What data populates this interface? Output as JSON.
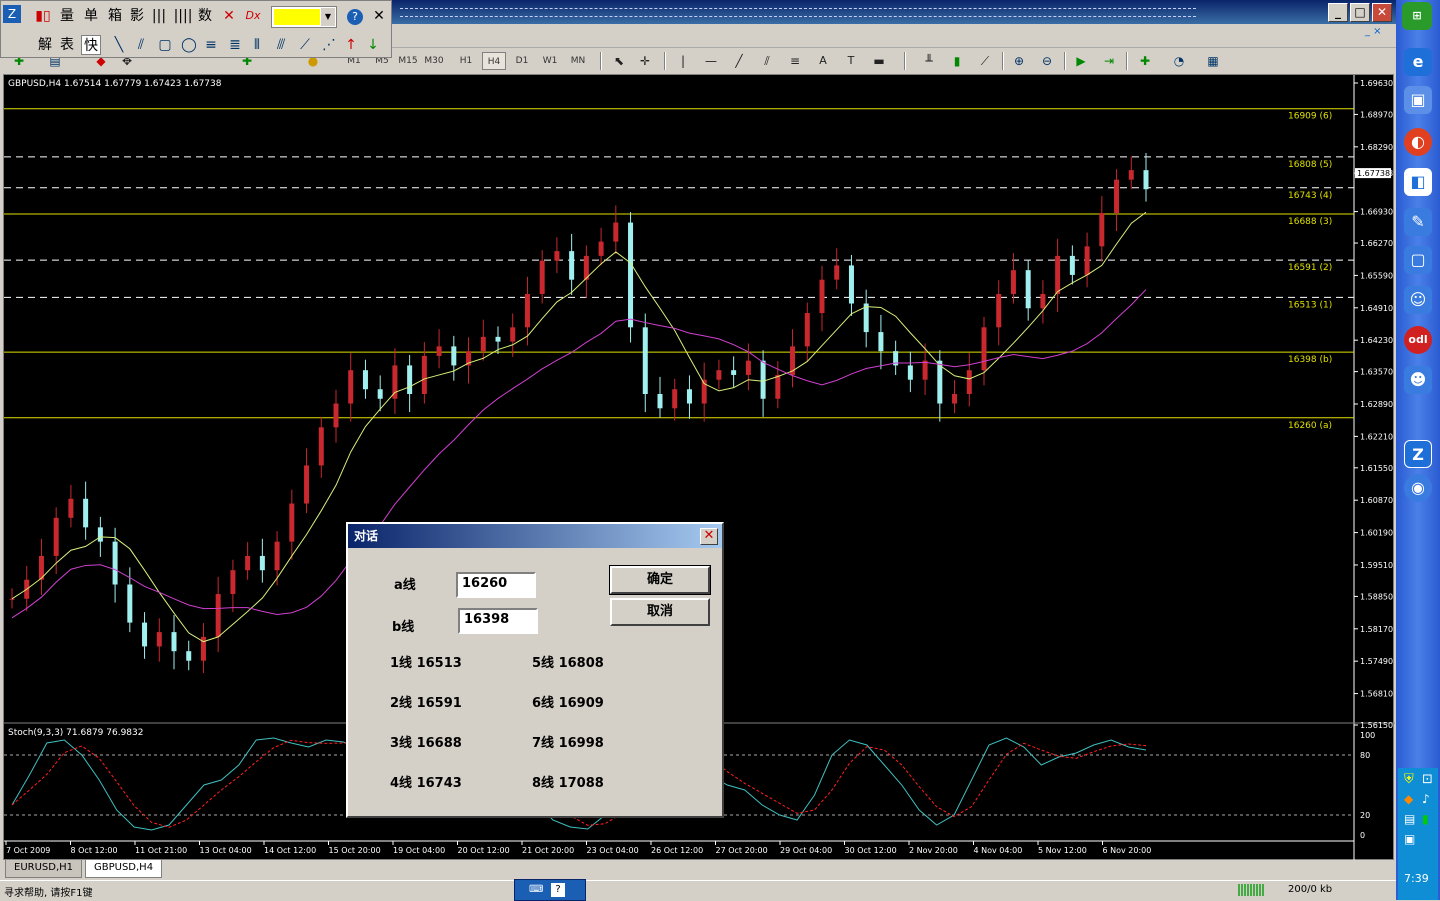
{
  "toolbar_float": {
    "row1": [
      "量",
      "单",
      "箱",
      "影",
      "数"
    ],
    "row2": [
      "解",
      "表",
      "快"
    ]
  },
  "timeframes": [
    "M1",
    "M5",
    "M15",
    "M30",
    "H1",
    "H4",
    "D1",
    "W1",
    "MN"
  ],
  "timeframe_selected": "H4",
  "chart": {
    "header": "GBPUSD,H4  1.67514 1.67779 1.67423 1.67738",
    "price_labels": [
      "1.69630",
      "1.68970",
      "1.68290",
      "1.67738",
      "1.66930",
      "1.66270",
      "1.65590",
      "1.64910",
      "1.64230",
      "1.63570",
      "1.62890",
      "1.62210",
      "1.61550",
      "1.60870",
      "1.60190",
      "1.59510",
      "1.58850",
      "1.58170",
      "1.57490",
      "1.56810",
      "1.56150"
    ],
    "current_price": "1.67738",
    "levels": [
      {
        "label": "16909 (6)",
        "value": 16909,
        "style": "solid"
      },
      {
        "label": "16808 (5)",
        "value": 16808,
        "style": "dashed"
      },
      {
        "label": "16743 (4)",
        "value": 16743,
        "style": "dashed"
      },
      {
        "label": "16688 (3)",
        "value": 16688,
        "style": "solid"
      },
      {
        "label": "16591 (2)",
        "value": 16591,
        "style": "dashed"
      },
      {
        "label": "16513 (1)",
        "value": 16513,
        "style": "dashed"
      },
      {
        "label": "16398 (b)",
        "value": 16398,
        "style": "solid"
      },
      {
        "label": "16260 (a)",
        "value": 16260,
        "style": "solid"
      }
    ],
    "stoch_label": "Stoch(9,3,3) 71.6879 76.9832",
    "stoch_levels": [
      "100",
      "80",
      "20",
      "0"
    ],
    "time_labels": [
      "7 Oct 2009",
      "8 Oct 12:00",
      "11 Oct 21:00",
      "13 Oct 04:00",
      "14 Oct 12:00",
      "15 Oct 20:00",
      "19 Oct 04:00",
      "20 Oct 12:00",
      "21 Oct 20:00",
      "23 Oct 04:00",
      "26 Oct 12:00",
      "27 Oct 20:00",
      "29 Oct 04:00",
      "30 Oct 12:00",
      "2 Nov 20:00",
      "4 Nov 04:00",
      "5 Nov 12:00",
      "6 Nov 20:00"
    ],
    "colors": {
      "bull": "#c8282e",
      "bear": "#a0f0f0",
      "ma_fast": "#d8f07a",
      "ma_slow": "#d040d0",
      "level": "#e0e000",
      "stoch_main": "#40c0c0",
      "stoch_signal": "#ff2020"
    }
  },
  "tabs": [
    "EURUSD,H1",
    "GBPUSD,H4"
  ],
  "active_tab": "GBPUSD,H4",
  "status": {
    "help": "寻求帮助, 请按F1键",
    "traffic": "200/0 kb",
    "clock": "7:39"
  },
  "dialog": {
    "title": "对话",
    "a_label": "a线",
    "a_value": "16260",
    "b_label": "b线",
    "b_value": "16398",
    "ok": "确定",
    "cancel": "取消",
    "lines": [
      "1线 16513",
      "2线 16591",
      "3线 16688",
      "4线 16743",
      "5线 16808",
      "6线 16909",
      "7线 16998",
      "8线 17088"
    ]
  }
}
